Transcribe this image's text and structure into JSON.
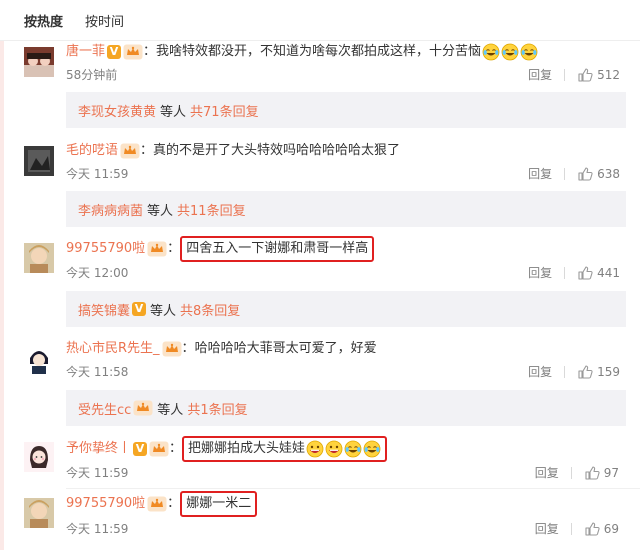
{
  "sort": {
    "active": "按热度",
    "inactive": "按时间"
  },
  "comments": [
    {
      "user": "唐一菲",
      "text": "我啥特效都没开，不知道为啥每次都拍成这样，十分苦恼",
      "emojis": [
        "laugh-cry-emoji",
        "laugh-cry-emoji",
        "laugh-cry-emoji"
      ],
      "time": "58分钟前",
      "reply": "回复",
      "likes": "512",
      "sub": {
        "names": "李现女孩黄黄",
        "mid": "等人",
        "more": "共71条回复"
      }
    },
    {
      "user": "毛的呓语",
      "text": "真的不是开了大头特效吗哈哈哈哈哈太狠了",
      "time": "今天 11:59",
      "reply": "回复",
      "likes": "638",
      "sub": {
        "names": "李病病病菌",
        "mid": "等人",
        "more": "共11条回复"
      }
    },
    {
      "user": "99755790啦",
      "text": "四舍五入一下谢娜和肃哥一样高",
      "time": "今天 12:00",
      "reply": "回复",
      "likes": "441",
      "sub": {
        "names": "搞笑锦囊",
        "mid": "等人",
        "more": "共8条回复"
      }
    },
    {
      "user": "热心市民R先生_",
      "text": "哈哈哈哈大菲哥太可爱了，好爱",
      "time": "今天 11:58",
      "reply": "回复",
      "likes": "159",
      "sub": {
        "names": "受先生cc",
        "mid": "等人",
        "more": "共1条回复"
      }
    },
    {
      "user": "予你挚终丨",
      "text": "把娜娜拍成大头娃娃",
      "emojis": [
        "grin-emoji",
        "grin-emoji",
        "laugh-cry-emoji",
        "laugh-cry-emoji"
      ],
      "time": "今天 11:59",
      "reply": "回复",
      "likes": "97"
    },
    {
      "user": "99755790啦",
      "text": "娜娜一米二",
      "time": "今天 11:59",
      "reply": "回复",
      "likes": "69"
    }
  ],
  "colors": {
    "username": "#eb7350",
    "highlight": "#e02020",
    "subbox_bg": "#f2f2f5",
    "meta": "#808080"
  }
}
